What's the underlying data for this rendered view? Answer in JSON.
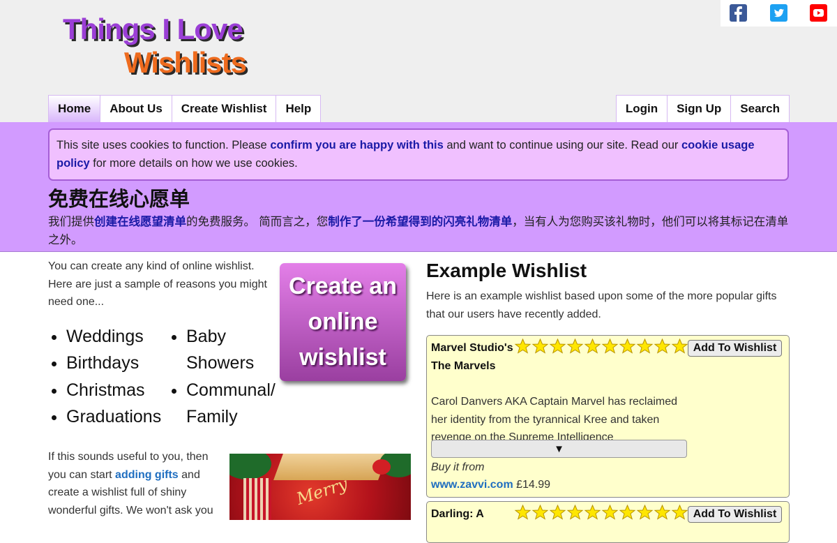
{
  "logo": {
    "line1": "Things I Love",
    "line2": "Wishlists"
  },
  "social": [
    "facebook-icon",
    "twitter-icon",
    "youtube-icon"
  ],
  "colors": {
    "header_bg": "#efefef",
    "band_bg": "#d29bff",
    "cookie_bg": "#f0c0ff",
    "card_bg": "#ffffcc",
    "cta_gradient": [
      "#e37fe8",
      "#9a3fa0"
    ],
    "link": "#1a1aa6"
  },
  "nav": {
    "left": [
      "Home",
      "About Us",
      "Create Wishlist",
      "Help"
    ],
    "right": [
      "Login",
      "Sign Up",
      "Search"
    ]
  },
  "cookie": {
    "t1": "This site uses cookies to function. Please ",
    "link1": "confirm you are happy with this",
    "t2": " and want to continue using our site. Read our ",
    "link2": "cookie usage policy",
    "t3": " for more details on how we use cookies."
  },
  "cn": {
    "title": "免费在线心愿单",
    "t1": "我们提供",
    "link1": "创建在线愿望清单",
    "t2": "的免费服务。 简而言之，您",
    "link2": "制作了一份希望得到的闪亮礼物清单",
    "t3": "，当有人为您购买该礼物时，他们可以将其标记在清单之外。"
  },
  "intro": "You can create any kind of online wishlist. Here are just a sample of reasons you might need one...",
  "reasons": {
    "col1": [
      "Weddings",
      "Birthdays",
      "Christmas",
      "Graduations"
    ],
    "col2": [
      "Baby Showers",
      "Communal/ Family"
    ]
  },
  "cta": {
    "line1": "Create an",
    "line2": "online",
    "line3": "wishlist"
  },
  "more": {
    "t1": "If this sounds useful to you, then you can start ",
    "link": "adding gifts",
    "t2": " and create a wishlist full of shiny wonderful gifts. We won't ask you"
  },
  "image_text": "Merry",
  "example": {
    "title": "Example Wishlist",
    "desc": "Here is an example wishlist based upon some of the more popular gifts that our users have recently added.",
    "items": [
      {
        "title": "Marvel Studio's The Marvels",
        "stars": 10,
        "button": "Add To Wishlist",
        "description": "Carol Danvers AKA Captain Marvel has reclaimed her identity from the tyrannical Kree and taken revenge on the Supreme Intelligence",
        "expand": "▼",
        "buy_label": "Buy it from",
        "store": "www.zavvi.com",
        "price": "£14.99"
      },
      {
        "title": "Darling: A",
        "stars": 10,
        "button": "Add To Wishlist"
      }
    ]
  }
}
